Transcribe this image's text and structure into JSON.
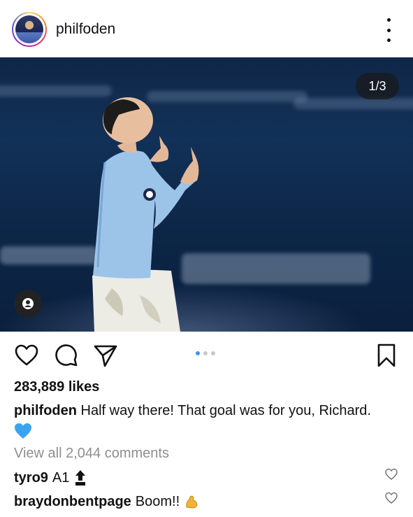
{
  "post": {
    "username": "philfoden",
    "image_counter": "1/3",
    "likes": "283,889 likes",
    "caption_user": "philfoden",
    "caption_text": "Half way there! That goal was for you, Richard.",
    "caption_emoji": "blue-heart-emoji",
    "view_comments": "View all 2,044 comments",
    "carousel": {
      "count": 3,
      "active_index": 0
    }
  },
  "comments": [
    {
      "user": "tyro9",
      "text": "A1",
      "emoji": "top-arrow-emoji"
    },
    {
      "user": "braydonbentpage",
      "text": "Boom!!",
      "emoji": "flexed-biceps-emoji"
    }
  ],
  "icons": {
    "more": "more-options-icon",
    "like": "heart-icon",
    "comment": "comment-icon",
    "share": "send-icon",
    "save": "bookmark-icon",
    "tag": "user-tag-icon"
  },
  "colors": {
    "carousel_active": "#3897f0",
    "muted_text": "#8e8e8e",
    "photo_bg": "#0f2747",
    "kit_blue": "#9cc4e8"
  }
}
